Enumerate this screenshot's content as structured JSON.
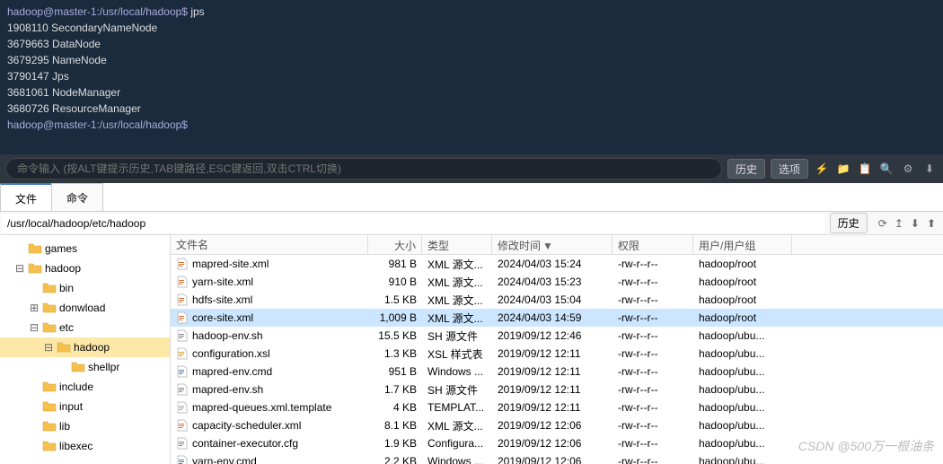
{
  "terminal": {
    "lines": [
      {
        "prompt": "hadoop@master-1:/usr/local/hadoop$",
        "cmd": " jps"
      },
      {
        "text": "1908110 SecondaryNameNode"
      },
      {
        "text": "3679663 DataNode"
      },
      {
        "text": "3679295 NameNode"
      },
      {
        "text": "3790147 Jps"
      },
      {
        "text": "3681061 NodeManager"
      },
      {
        "text": "3680726 ResourceManager"
      },
      {
        "prompt": "hadoop@master-1:/usr/local/hadoop$",
        "cmd": ""
      }
    ]
  },
  "cmdbar": {
    "placeholder": "命令输入 (按ALT键提示历史,TAB键路径,ESC键返回,双击CTRL切换)",
    "history": "历史",
    "options": "选项"
  },
  "tabs": {
    "items": [
      "文件",
      "命令"
    ],
    "active": 0
  },
  "pathbar": {
    "path": "/usr/local/hadoop/etc/hadoop",
    "history": "历史"
  },
  "tree": {
    "items": [
      {
        "depth": 1,
        "toggle": "",
        "label": "games",
        "open": false
      },
      {
        "depth": 1,
        "toggle": "⊟",
        "label": "hadoop",
        "open": true
      },
      {
        "depth": 2,
        "toggle": "",
        "label": "bin",
        "open": false
      },
      {
        "depth": 2,
        "toggle": "⊞",
        "label": "donwload",
        "open": false
      },
      {
        "depth": 2,
        "toggle": "⊟",
        "label": "etc",
        "open": true
      },
      {
        "depth": 3,
        "toggle": "⊟",
        "label": "hadoop",
        "open": true,
        "selected": true
      },
      {
        "depth": 4,
        "toggle": "",
        "label": "shellpr",
        "open": false
      },
      {
        "depth": 2,
        "toggle": "",
        "label": "include",
        "open": false
      },
      {
        "depth": 2,
        "toggle": "",
        "label": "input",
        "open": false
      },
      {
        "depth": 2,
        "toggle": "",
        "label": "lib",
        "open": false
      },
      {
        "depth": 2,
        "toggle": "",
        "label": "libexec",
        "open": false
      }
    ]
  },
  "filelist": {
    "headers": {
      "name": "文件名",
      "size": "大小",
      "type": "类型",
      "mod": "修改时间",
      "perm": "权限",
      "user": "用户/用户组"
    },
    "rows": [
      {
        "icon": "xml",
        "name": "mapred-site.xml",
        "size": "981 B",
        "type": "XML 源文...",
        "mod": "2024/04/03 15:24",
        "perm": "-rw-r--r--",
        "user": "hadoop/root"
      },
      {
        "icon": "xml",
        "name": "yarn-site.xml",
        "size": "910 B",
        "type": "XML 源文...",
        "mod": "2024/04/03 15:23",
        "perm": "-rw-r--r--",
        "user": "hadoop/root"
      },
      {
        "icon": "xml",
        "name": "hdfs-site.xml",
        "size": "1.5 KB",
        "type": "XML 源文...",
        "mod": "2024/04/03 15:04",
        "perm": "-rw-r--r--",
        "user": "hadoop/root"
      },
      {
        "icon": "xml",
        "name": "core-site.xml",
        "size": "1,009 B",
        "type": "XML 源文...",
        "mod": "2024/04/03 14:59",
        "perm": "-rw-r--r--",
        "user": "hadoop/root",
        "selected": true
      },
      {
        "icon": "sh",
        "name": "hadoop-env.sh",
        "size": "15.5 KB",
        "type": "SH 源文件",
        "mod": "2019/09/12 12:46",
        "perm": "-rw-r--r--",
        "user": "hadoop/ubu..."
      },
      {
        "icon": "xsl",
        "name": "configuration.xsl",
        "size": "1.3 KB",
        "type": "XSL 样式表",
        "mod": "2019/09/12 12:11",
        "perm": "-rw-r--r--",
        "user": "hadoop/ubu..."
      },
      {
        "icon": "cmd",
        "name": "mapred-env.cmd",
        "size": "951 B",
        "type": "Windows ...",
        "mod": "2019/09/12 12:11",
        "perm": "-rw-r--r--",
        "user": "hadoop/ubu..."
      },
      {
        "icon": "sh",
        "name": "mapred-env.sh",
        "size": "1.7 KB",
        "type": "SH 源文件",
        "mod": "2019/09/12 12:11",
        "perm": "-rw-r--r--",
        "user": "hadoop/ubu..."
      },
      {
        "icon": "tpl",
        "name": "mapred-queues.xml.template",
        "size": "4 KB",
        "type": "TEMPLAT...",
        "mod": "2019/09/12 12:11",
        "perm": "-rw-r--r--",
        "user": "hadoop/ubu..."
      },
      {
        "icon": "xml",
        "name": "capacity-scheduler.xml",
        "size": "8.1 KB",
        "type": "XML 源文...",
        "mod": "2019/09/12 12:06",
        "perm": "-rw-r--r--",
        "user": "hadoop/ubu..."
      },
      {
        "icon": "cfg",
        "name": "container-executor.cfg",
        "size": "1.9 KB",
        "type": "Configura...",
        "mod": "2019/09/12 12:06",
        "perm": "-rw-r--r--",
        "user": "hadoop/ubu..."
      },
      {
        "icon": "cmd",
        "name": "yarn-env.cmd",
        "size": "2.2 KB",
        "type": "Windows ...",
        "mod": "2019/09/12 12:06",
        "perm": "-rw-r--r--",
        "user": "hadoop/ubu..."
      }
    ]
  },
  "watermark": "CSDN @500万一根油条"
}
